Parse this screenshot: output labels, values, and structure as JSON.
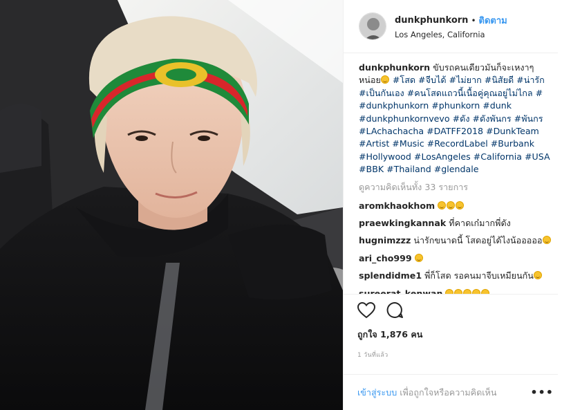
{
  "post": {
    "username": "dunkphunkorn",
    "separator": "•",
    "follow_label": "ติดตาม",
    "location": "Los Angeles, California"
  },
  "caption": {
    "author": "dunkphunkorn",
    "text": "ขับรถคนเดียวมันก็จะเหงาๆหน่อย",
    "tags_line": "#โสด #จีบได้ #ไม่ยาก #นิสัยดี #น่ารัก #เป็นกันเอง #คนโสดแถวนี้เนื้อคู่คุณอยู่ไม่ไกล # #dunkphunkorn #phunkorn #dunk #dunkphunkornvevo #ดัง #ดังพันกร #พันกร #LAchachacha #DATFF2018 #DunkTeam #Artist #Music #RecordLabel #Burbank #Hollywood #LosAngeles #California #USA #BBK #Thailand #glendale"
  },
  "view_all_comments": "ดูความคิดเห็นทั้ง 33 รายการ",
  "comments": [
    {
      "author": "aromkhaokhom",
      "text": "",
      "emoji_count": 3
    },
    {
      "author": "praewkingkannak",
      "text": "ที่คาดเก๋มากพี่ดัง",
      "emoji_count": 0
    },
    {
      "author": "hugnimzzz",
      "text": "น่ารักขนาดนี้ โสดอยู่ได้ไงน้อออออ",
      "emoji_count": 1
    },
    {
      "author": "ari_cho999",
      "text": "",
      "emoji_count": 1
    },
    {
      "author": "splendidme1",
      "text": "พี่ก็โสด รอคนมาจีบเหมียนกัน",
      "emoji_count": 1
    },
    {
      "author": "sureerat_kenwan",
      "text": "",
      "emoji_count": 5
    }
  ],
  "actions": {
    "like_icon": "heart-icon",
    "comment_icon": "comment-bubble-icon"
  },
  "likes_text": "ถูกใจ 1,876 คน",
  "time_ago": "1 วันที่แล้ว",
  "footer": {
    "login_link": "เข้าสู่ระบบ",
    "login_rest": "เพื่อถูกใจหรือความคิดเห็น",
    "more_label": "•••"
  },
  "colors": {
    "link_blue": "#3897f0",
    "hashtag": "#003569",
    "muted": "#999999",
    "text": "#262626"
  }
}
